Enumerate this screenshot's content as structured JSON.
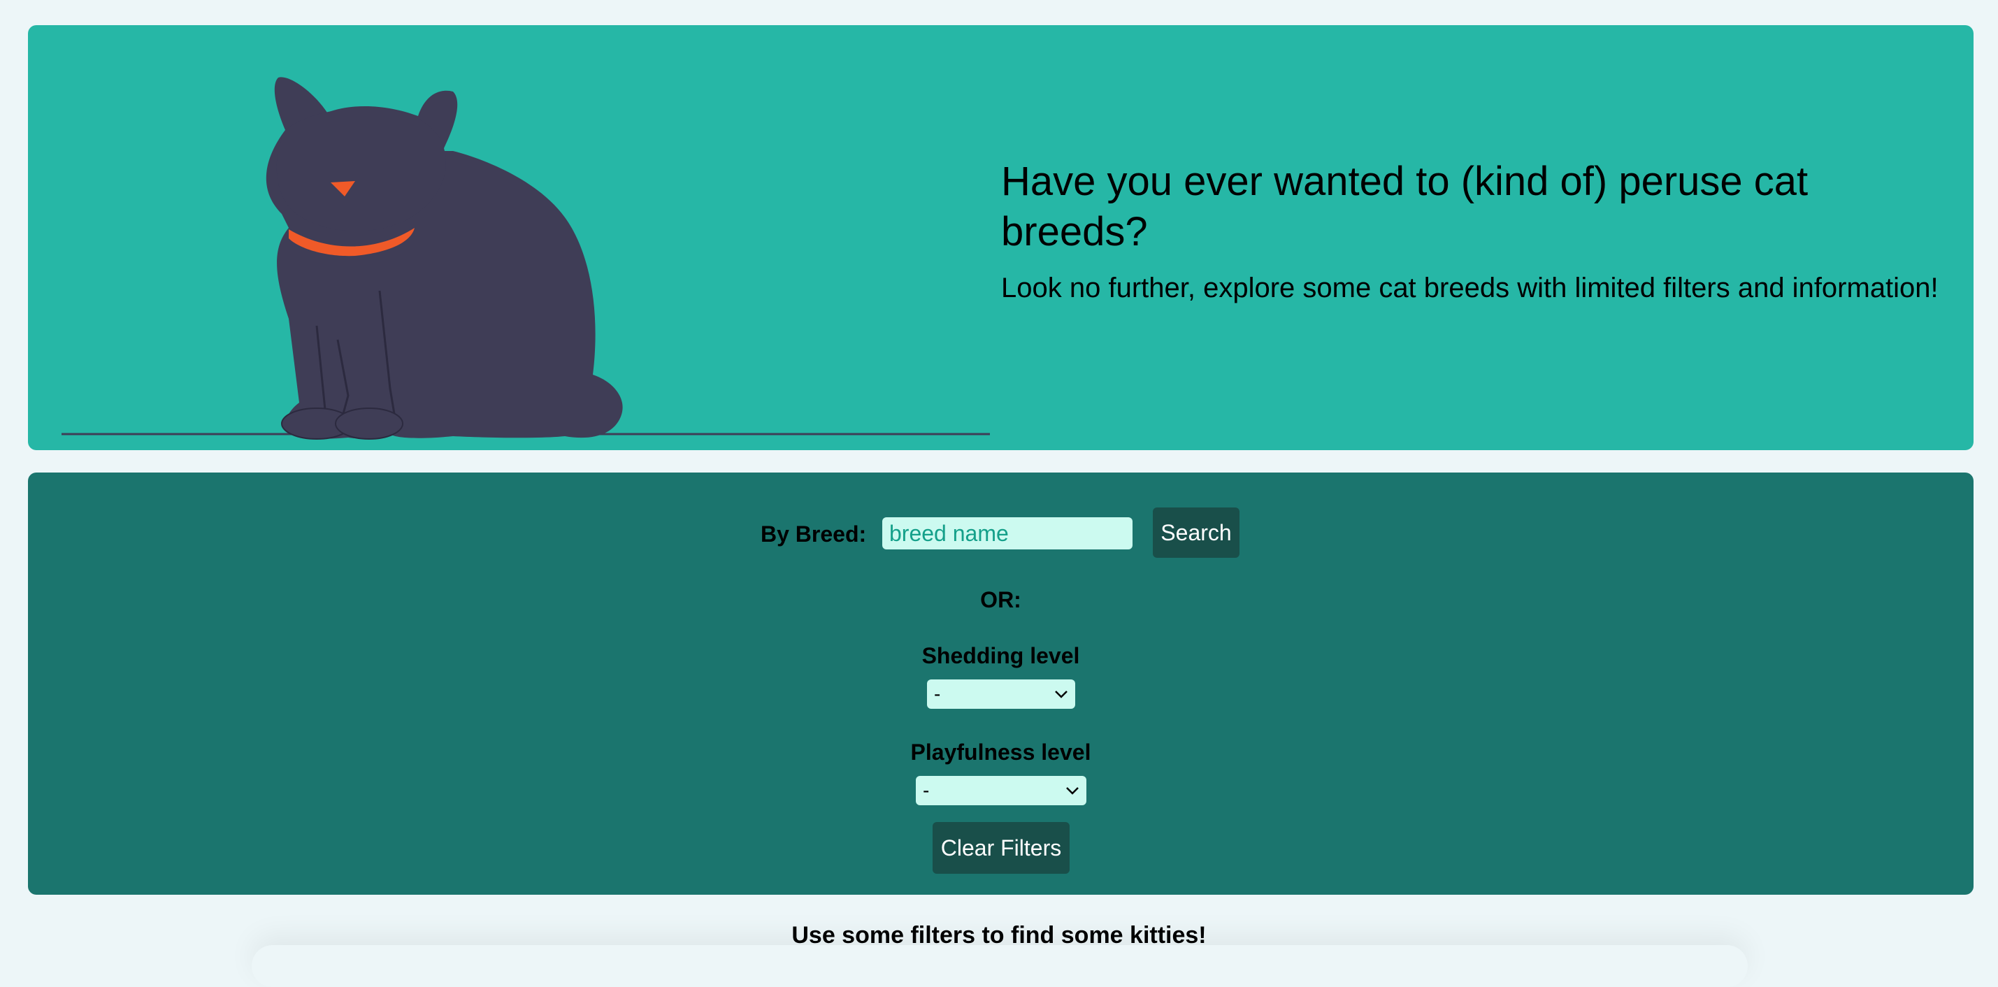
{
  "hero": {
    "title": "Have you ever wanted to (kind of) peruse cat breeds?",
    "subtitle": "Look no further, explore some cat breeds with limited filters and information!",
    "illustration_icon": "sitting-cat-illustration"
  },
  "filters": {
    "breed_label": "By Breed:",
    "breed_input_value": "",
    "breed_input_placeholder": "breed name",
    "search_label": "Search",
    "or_label": "OR:",
    "shedding_label": "Shedding level",
    "shedding_selected": "-",
    "playfulness_label": "Playfulness level",
    "playfulness_selected": "-",
    "clear_label": "Clear Filters"
  },
  "results": {
    "message": "Use some filters to find some kitties!"
  },
  "colors": {
    "page_background": "#edf6f8",
    "hero_background": "#26b7a6",
    "filters_background": "#1b756e",
    "button_background": "#194f4a",
    "input_background": "#ccfaf0",
    "cat_body": "#3f3d56",
    "cat_accent": "#f05a28"
  }
}
